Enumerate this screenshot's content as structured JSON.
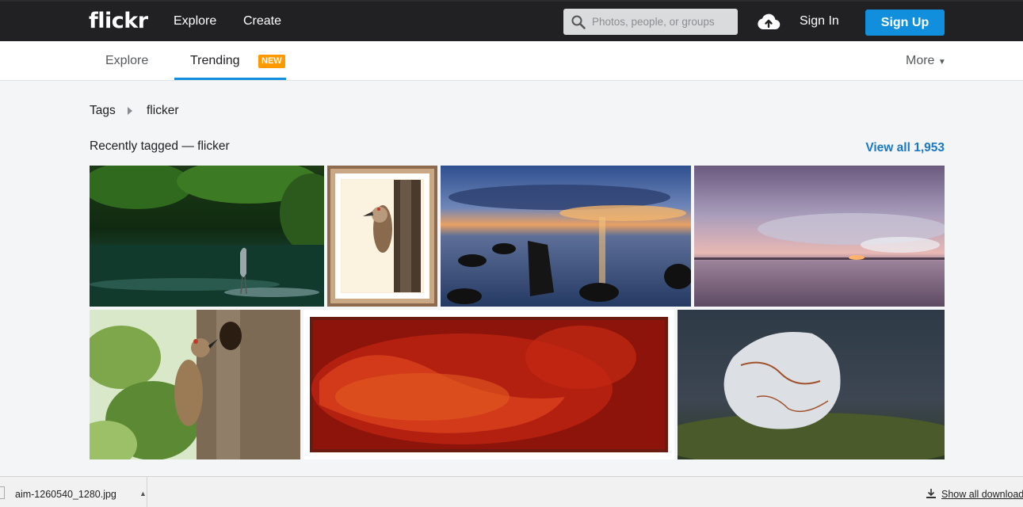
{
  "header": {
    "logo": "flickr",
    "nav": [
      "Explore",
      "Create"
    ],
    "search_placeholder": "Photos, people, or groups",
    "sign_in": "Sign In",
    "sign_up": "Sign Up"
  },
  "subnav": {
    "tabs": [
      "Explore",
      "Trending"
    ],
    "active_tab": "Trending",
    "new_badge": "NEW",
    "more": "More"
  },
  "breadcrumb": {
    "root": "Tags",
    "current": "flicker"
  },
  "section": {
    "title": "Recently tagged — flicker",
    "view_all": "View all 1,953"
  },
  "downloads": {
    "file": "aim-1260540_1280.jpg",
    "show_all": "Show all downloads"
  },
  "colors": {
    "accent": "#128fdc",
    "badge": "#ff9900",
    "link": "#1b78c5",
    "topbar": "#212124"
  }
}
